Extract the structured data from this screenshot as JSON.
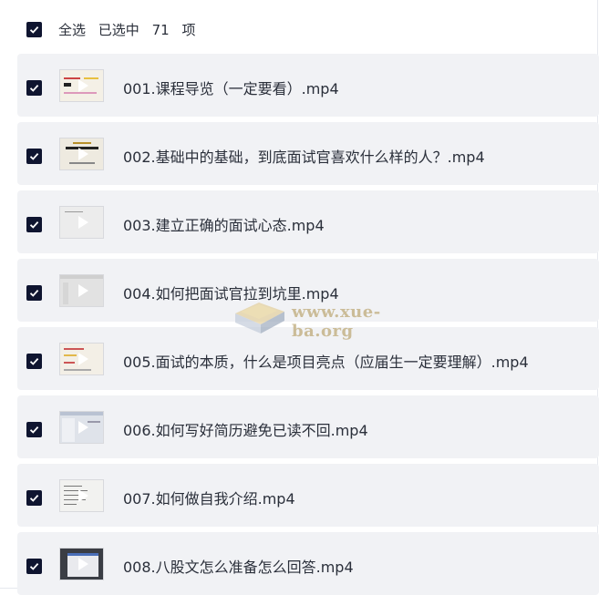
{
  "header": {
    "select_all_label": "全选",
    "selected_prefix": "已选中",
    "selected_count": "71",
    "selected_suffix": "项"
  },
  "files": [
    {
      "name": "001.课程导览（一定要看）.mp4",
      "checked": true
    },
    {
      "name": "002.基础中的基础，到底面试官喜欢什么样的人？.mp4",
      "checked": true
    },
    {
      "name": "003.建立正确的面试心态.mp4",
      "checked": true
    },
    {
      "name": "004.如何把面试官拉到坑里.mp4",
      "checked": true
    },
    {
      "name": "005.面试的本质，什么是项目亮点（应届生一定要理解）.mp4",
      "checked": true
    },
    {
      "name": "006.如何写好简历避免已读不回.mp4",
      "checked": true
    },
    {
      "name": "007.如何做自我介绍.mp4",
      "checked": true
    },
    {
      "name": "008.八股文怎么准备怎么回答.mp4",
      "checked": true
    }
  ],
  "watermark": {
    "text": "www.xue-ba.org"
  },
  "colors": {
    "checkbox": "#0f1530",
    "row_bg": "#f1f2f5",
    "text": "#2a2f3a"
  }
}
